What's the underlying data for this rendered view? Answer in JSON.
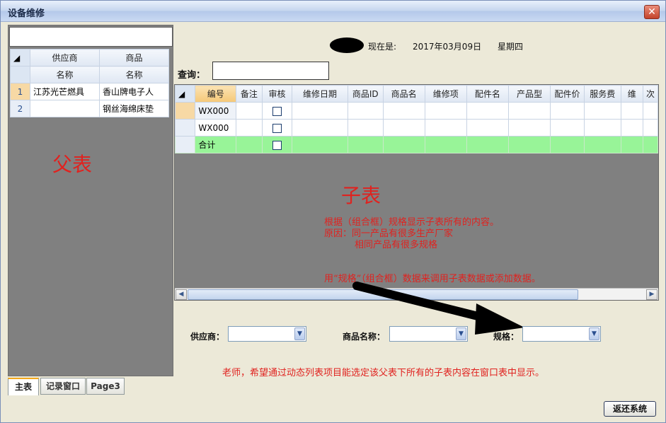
{
  "window": {
    "title": "设备维修",
    "close_label": "✕"
  },
  "parent": {
    "search_value": "",
    "group_headers": [
      "供应商",
      "商品"
    ],
    "sub_headers": [
      "名称",
      "名称"
    ],
    "rows": [
      {
        "num": "1",
        "supplier": "江苏光芒燃具",
        "product": "香山牌电子人"
      },
      {
        "num": "2",
        "supplier": "",
        "product": "钢丝海绵床垫"
      }
    ],
    "label": "父表"
  },
  "tabs": [
    "主表",
    "记录窗口",
    "Page3"
  ],
  "header": {
    "now_label": "现在是:",
    "date": "2017年03月09日",
    "weekday": "星期四"
  },
  "query": {
    "label": "查询：",
    "value": ""
  },
  "child": {
    "columns": [
      "编号",
      "备注",
      "审核",
      "维修日期",
      "商品ID",
      "商品名",
      "维修项",
      "配件名",
      "产品型",
      "配件价",
      "服务费",
      "维",
      "次"
    ],
    "rows": [
      {
        "id": "WX000"
      },
      {
        "id": "WX000"
      }
    ],
    "sum_label": "合计",
    "label": "子表",
    "notes": [
      "根据（组合框）规格显示子表所有的内容。",
      "原因：同一产品有很多生产厂家",
      "相同产品有很多规格",
      "用“规格”（组合框）数据来调用子表数据或添加数据。"
    ]
  },
  "combos": {
    "supplier_label": "供应商：",
    "product_label": "商品名称：",
    "spec_label": "规格："
  },
  "teacher_note": "老师，希望通过动态列表项目能选定该父表下所有的子表内容在窗口表中显示。",
  "back_button": "返还系统"
}
